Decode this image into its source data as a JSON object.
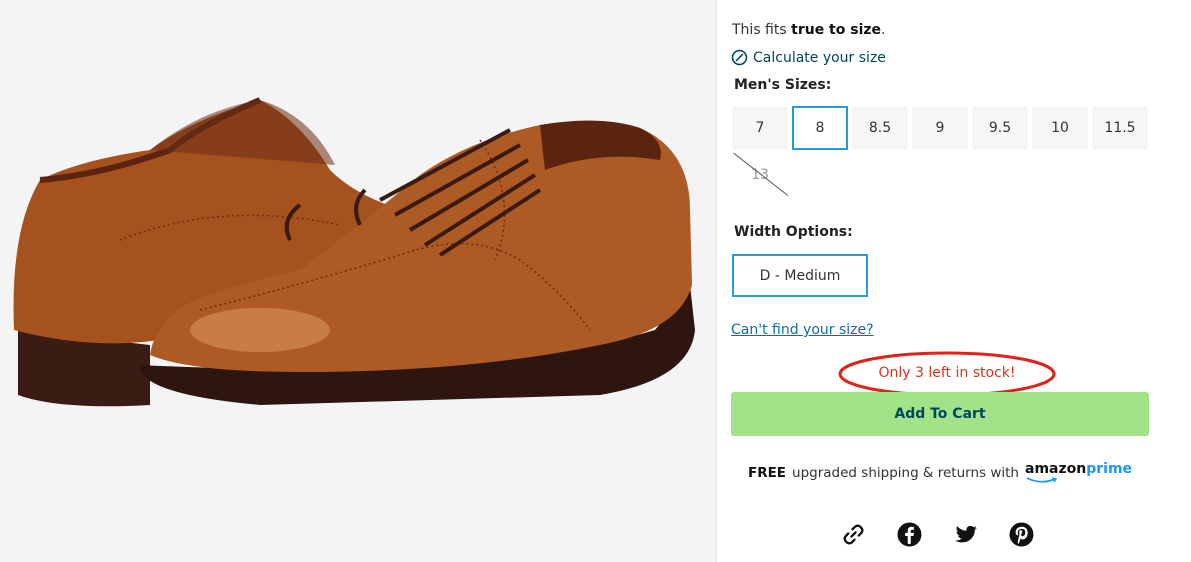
{
  "fit": {
    "prefix": "This fits ",
    "emphasis": "true to size",
    "suffix": "."
  },
  "calculate_link": "Calculate your size",
  "sizes": {
    "label": "Men's Sizes:",
    "options": [
      "7",
      "8",
      "8.5",
      "9",
      "9.5",
      "10",
      "11.5",
      "13"
    ],
    "selected": "8",
    "unavailable": [
      "13"
    ]
  },
  "width": {
    "label": "Width Options:",
    "selected": "D - Medium"
  },
  "cant_find_link": "Can't find your size?",
  "stock_notice": "Only 3 left in stock!",
  "add_to_cart": "Add To Cart",
  "shipping": {
    "free": "FREE",
    "text": "upgraded shipping & returns with",
    "brand_amazon": "amazon",
    "brand_prime": "prime"
  },
  "share_icons": [
    "link-icon",
    "facebook-icon",
    "twitter-icon",
    "pinterest-icon"
  ],
  "colors": {
    "accent_blue": "#2b9ad6",
    "add_to_cart_bg": "#a2e38a",
    "stock_red": "#d9341f",
    "link_teal": "#00465a"
  }
}
